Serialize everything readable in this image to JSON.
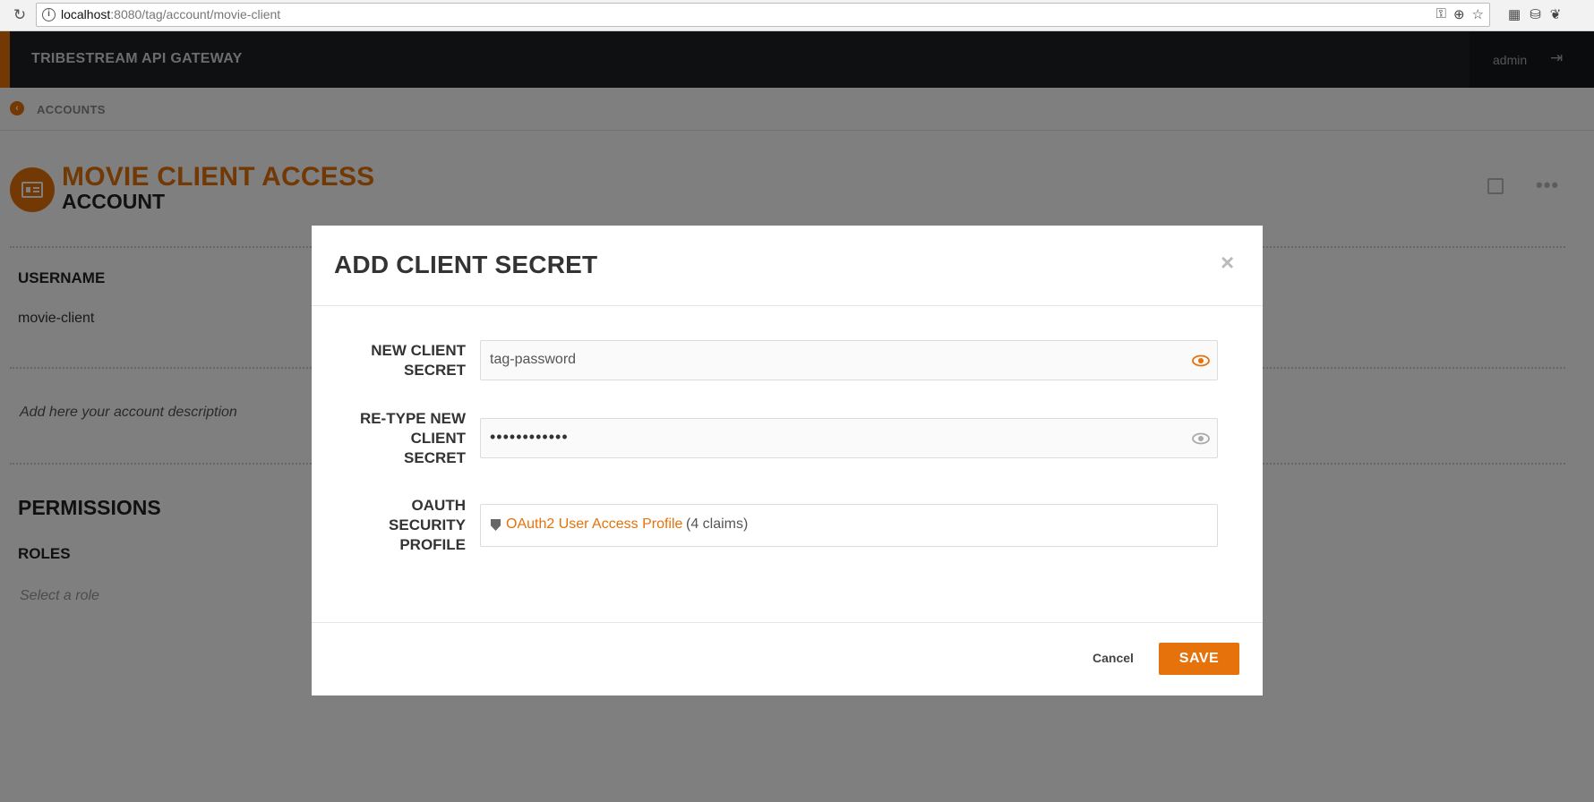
{
  "browser": {
    "url_host": "localhost",
    "url_rest": ":8080/tag/account/movie-client",
    "icons": [
      "key-icon",
      "zoom-icon",
      "star-icon"
    ],
    "extensions": [
      "calendar-ext-icon",
      "db-ext-icon",
      "feedly-ext-icon"
    ]
  },
  "header": {
    "brand": "TRIBESTREAM API GATEWAY",
    "user": "admin"
  },
  "breadcrumb": {
    "label": "ACCOUNTS"
  },
  "account": {
    "title": "MOVIE CLIENT ACCESS",
    "subtitle": "ACCOUNT",
    "username_label": "USERNAME",
    "username": "movie-client",
    "description_placeholder": "Add here your account description",
    "permissions_label": "PERMISSIONS",
    "roles_label": "ROLES",
    "role_placeholder": "Select a role"
  },
  "modal": {
    "title": "ADD CLIENT SECRET",
    "new_secret_label_1": "NEW CLIENT",
    "new_secret_label_2": "SECRET",
    "new_secret_value": "tag-password",
    "retype_label_1": "RE-TYPE NEW",
    "retype_label_2": "CLIENT",
    "retype_label_3": "SECRET",
    "retype_value_masked": "••••••••••••",
    "oauth_label_1": "OAUTH",
    "oauth_label_2": "SECURITY",
    "oauth_label_3": "PROFILE",
    "oauth_profile": "OAuth2 User Access Profile",
    "oauth_claims": "(4 claims)",
    "cancel": "Cancel",
    "save": "SAVE"
  },
  "colors": {
    "accent": "#e5720a",
    "header_bg": "#1e2023"
  }
}
